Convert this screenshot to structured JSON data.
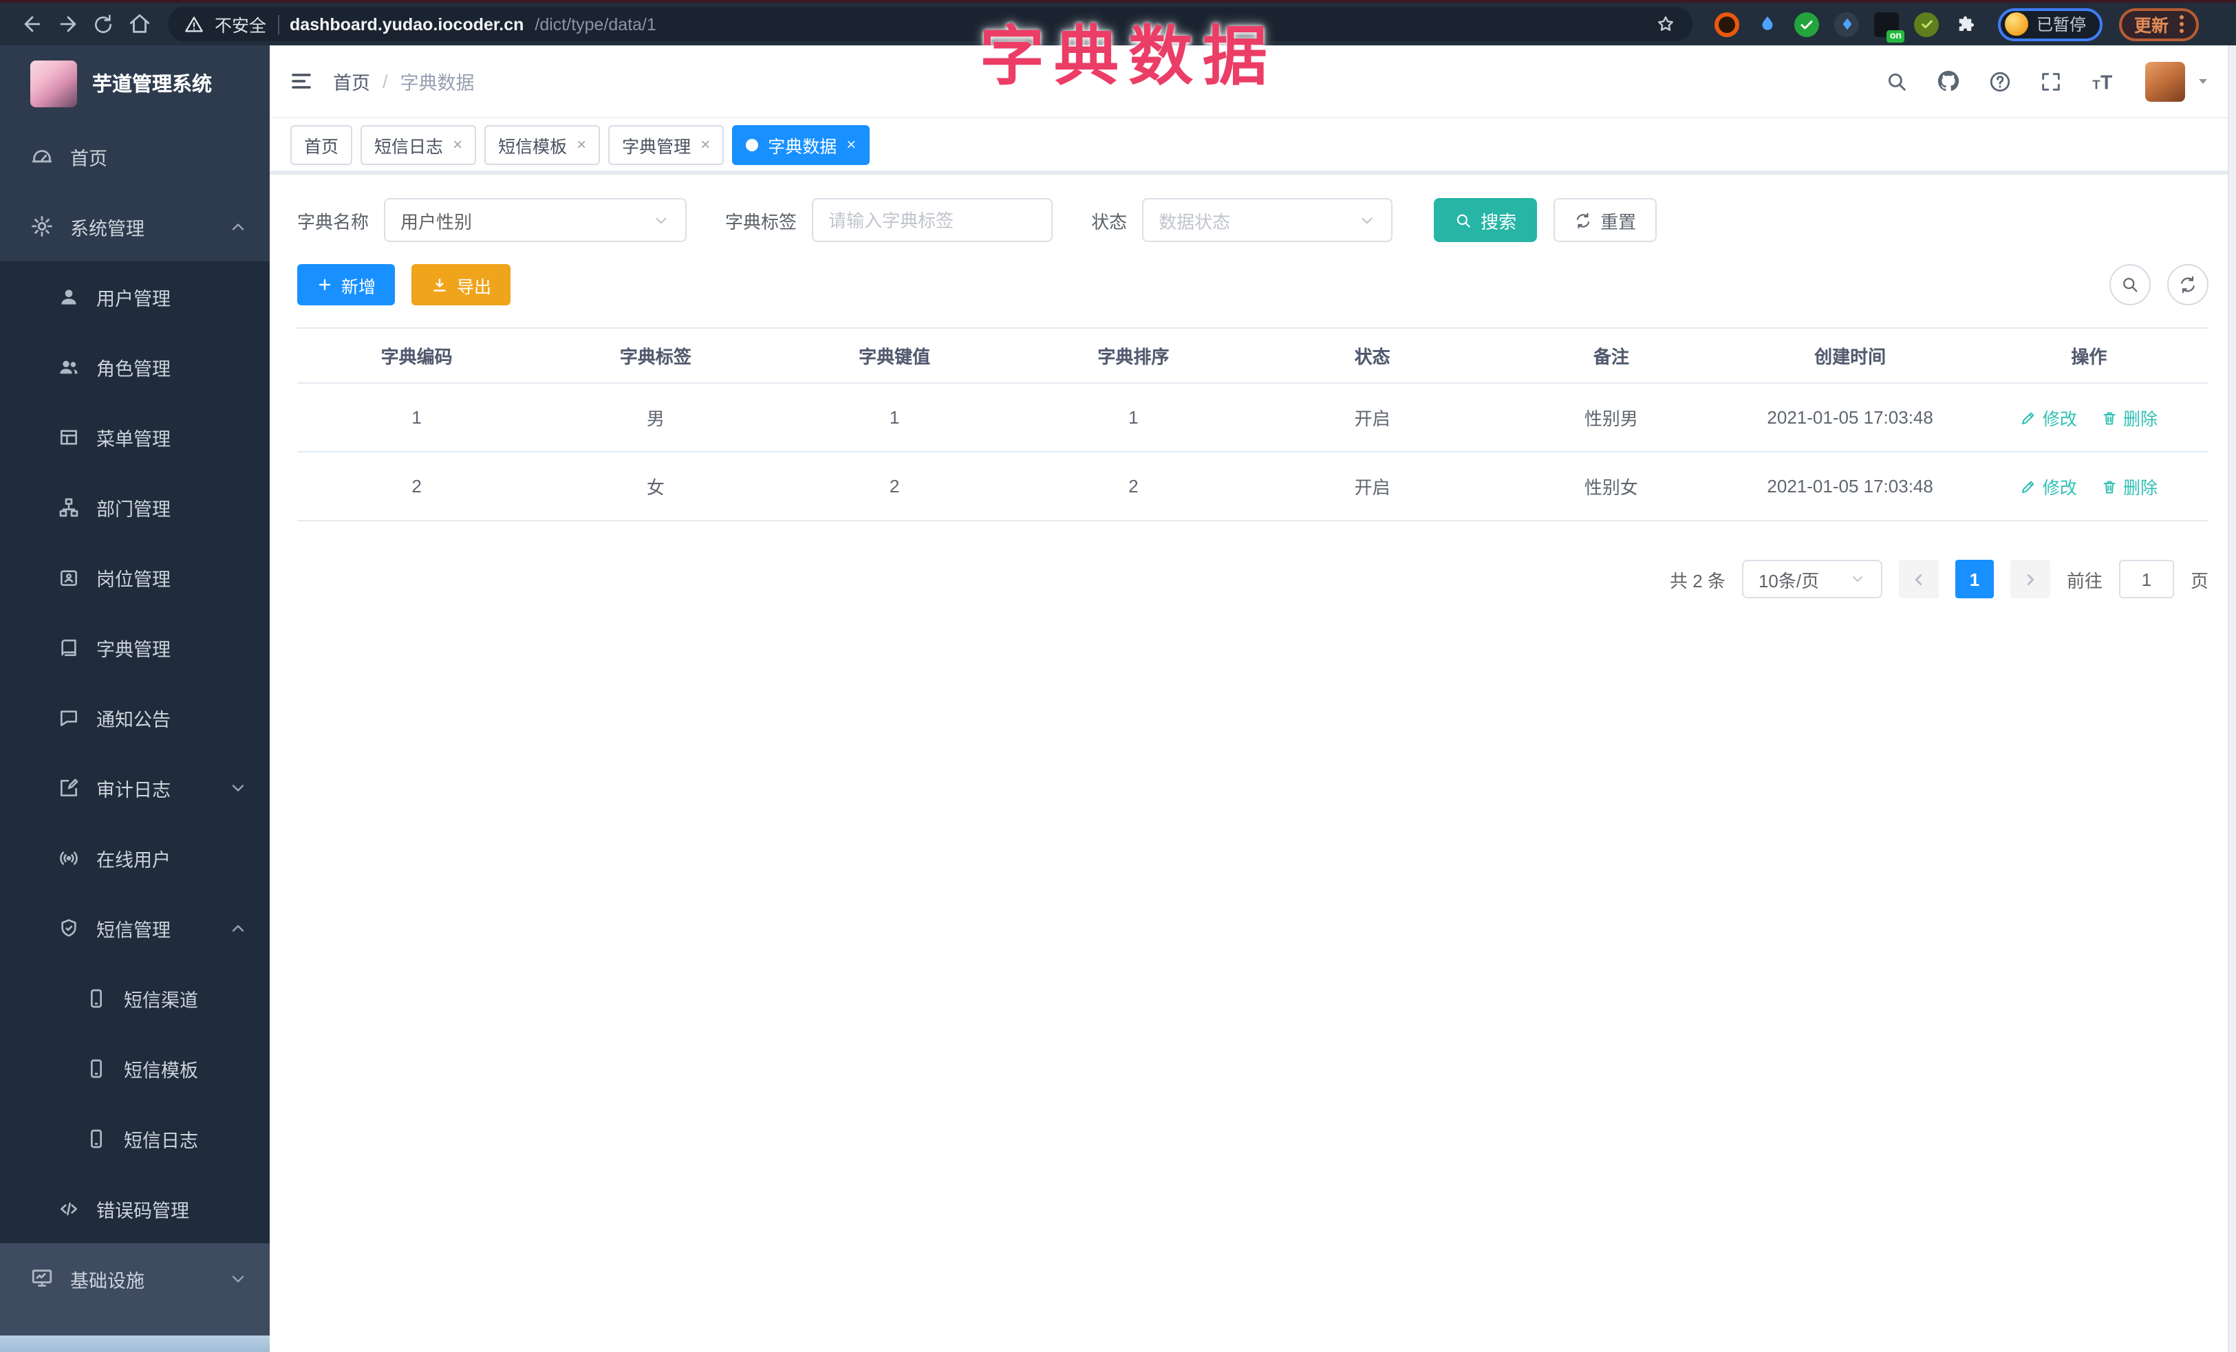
{
  "colors": {
    "accent_blue": "#1890ff",
    "search_teal": "#27b5a6",
    "export_orange": "#efa41b",
    "overlay_pink": "#eb3d66",
    "action_link_teal": "#2fbfb3",
    "chrome_bg": "#222e3b",
    "sidebar_bg": "#202c3b",
    "sidebar_top_bg": "#2e3b4e",
    "sidebar_infra_bg": "#3f4b61"
  },
  "overlay": {
    "title": "字典数据"
  },
  "browser": {
    "not_secure": "不安全",
    "url_host": "dashboard.yudao.iocoder.cn",
    "url_path": "/dict/type/data/1",
    "nav_icons": [
      "back-arrow-icon",
      "forward-arrow-icon",
      "reload-icon",
      "home-icon"
    ],
    "star_icon": "bookmark-star-icon",
    "extension_icons": [
      "orange-ring-extension-icon",
      "blue-drop-extension-icon",
      "green-check-extension-icon",
      "chart-extension-icon",
      "on-badge-extension-icon",
      "lime-extension-icon",
      "puzzle-extensions-icon"
    ],
    "on_badge": "on",
    "profile_status": "已暂停",
    "update_button": "更新"
  },
  "sidebar": {
    "logo_title": "芋道管理系统",
    "items": [
      {
        "label": "首页",
        "icon": "gauge-icon"
      },
      {
        "label": "系统管理",
        "icon": "gear-icon",
        "arrow": "up"
      },
      {
        "label": "用户管理",
        "icon": "user-icon"
      },
      {
        "label": "角色管理",
        "icon": "users-icon"
      },
      {
        "label": "菜单管理",
        "icon": "list-icon"
      },
      {
        "label": "部门管理",
        "icon": "org-tree-icon"
      },
      {
        "label": "岗位管理",
        "icon": "badge-icon"
      },
      {
        "label": "字典管理",
        "icon": "book-icon"
      },
      {
        "label": "通知公告",
        "icon": "chat-icon"
      },
      {
        "label": "审计日志",
        "icon": "edit-square-icon",
        "arrow": "down"
      },
      {
        "label": "在线用户",
        "icon": "online-icon"
      },
      {
        "label": "短信管理",
        "icon": "shield-check-icon",
        "arrow": "up"
      },
      {
        "label": "短信渠道",
        "icon": "phone-icon"
      },
      {
        "label": "短信模板",
        "icon": "phone-icon"
      },
      {
        "label": "短信日志",
        "icon": "phone-icon"
      },
      {
        "label": "错误码管理",
        "icon": "code-icon"
      },
      {
        "label": "基础设施",
        "icon": "monitor-icon",
        "arrow": "down"
      }
    ]
  },
  "header": {
    "breadcrumb_home": "首页",
    "breadcrumb_sep": "/",
    "breadcrumb_current": "字典数据",
    "icons": [
      "search-icon",
      "github-icon",
      "help-icon",
      "fullscreen-icon",
      "font-size-icon",
      "avatar",
      "caret-down-icon"
    ]
  },
  "tabs": [
    {
      "label": "首页",
      "closable": false,
      "active": false
    },
    {
      "label": "短信日志",
      "closable": true,
      "active": false
    },
    {
      "label": "短信模板",
      "closable": true,
      "active": false
    },
    {
      "label": "字典管理",
      "closable": true,
      "active": false
    },
    {
      "label": "字典数据",
      "closable": true,
      "active": true
    }
  ],
  "tab_close_glyph": "×",
  "filters": {
    "dict_name_label": "字典名称",
    "dict_name_value": "用户性别",
    "dict_tag_label": "字典标签",
    "dict_tag_placeholder": "请输入字典标签",
    "status_label": "状态",
    "status_placeholder": "数据状态",
    "search_button": "搜索",
    "reset_button": "重置"
  },
  "toolbar": {
    "add_button": "新增",
    "export_button": "导出"
  },
  "table": {
    "headers": [
      "字典编码",
      "字典标签",
      "字典键值",
      "字典排序",
      "状态",
      "备注",
      "创建时间",
      "操作"
    ],
    "rows": [
      {
        "code": "1",
        "label": "男",
        "value": "1",
        "sort": "1",
        "status": "开启",
        "remark": "性别男",
        "created": "2021-01-05 17:03:48"
      },
      {
        "code": "2",
        "label": "女",
        "value": "2",
        "sort": "2",
        "status": "开启",
        "remark": "性别女",
        "created": "2021-01-05 17:03:48"
      }
    ],
    "edit_action": "修改",
    "delete_action": "删除"
  },
  "pagination": {
    "total": "共 2 条",
    "page_size": "10条/页",
    "current_page": "1",
    "goto_label": "前往",
    "goto_value": "1",
    "page_suffix": "页"
  }
}
